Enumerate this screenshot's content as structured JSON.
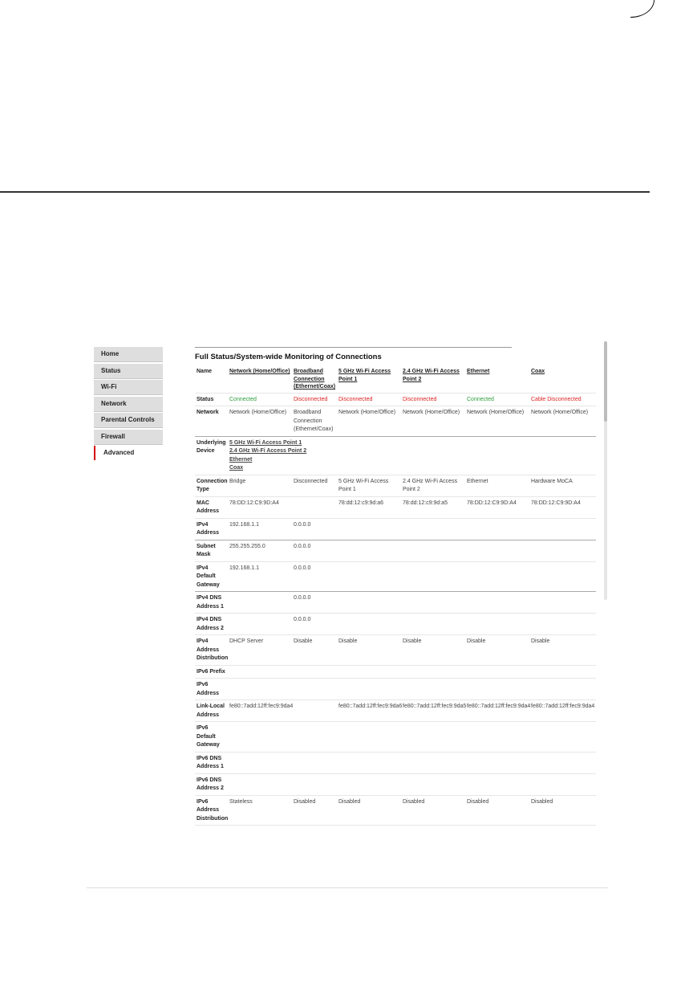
{
  "sidebar": {
    "items": [
      {
        "label": "Home"
      },
      {
        "label": "Status"
      },
      {
        "label": "Wi-Fi"
      },
      {
        "label": "Network"
      },
      {
        "label": "Parental Controls"
      },
      {
        "label": "Firewall"
      },
      {
        "label": "Advanced",
        "active": true
      }
    ]
  },
  "main": {
    "title": "Full Status/System-wide Monitoring of Connections",
    "columns": {
      "name_label": "Name",
      "c1": "Network (Home/Office)",
      "c2": "Broadband Connection (Ethernet/Coax)",
      "c3": "5 GHz Wi-Fi Access Point 1",
      "c4": "2.4 GHz Wi-Fi Access Point 2",
      "c5": "Ethernet",
      "c6": "Coax"
    },
    "rows": {
      "status": {
        "label": "Status",
        "c1": "Connected",
        "c2": "Disconnected",
        "c3": "Disconnected",
        "c4": "Disconnected",
        "c5": "Connected",
        "c6": "Cable Disconnected"
      },
      "network": {
        "label": "Network",
        "c1": "Network (Home/Office)",
        "c2": "Broadband Connection (Ethernet/Coax)",
        "c3": "Network (Home/Office)",
        "c4": "Network (Home/Office)",
        "c5": "Network (Home/Office)",
        "c6": "Network (Home/Office)"
      },
      "underlying": {
        "label": "Underlying Device",
        "links": [
          "5 GHz Wi-Fi Access Point 1",
          "2.4 GHz Wi-Fi Access Point 2",
          "Ethernet",
          "Coax"
        ]
      },
      "conn_type": {
        "label": "Connection Type",
        "c1": "Bridge",
        "c2": "Disconnected",
        "c3": "5 GHz Wi-Fi Access Point 1",
        "c4": "2.4 GHz Wi-Fi Access Point 2",
        "c5": "Ethernet",
        "c6": "Hardware MoCA"
      },
      "mac": {
        "label": "MAC Address",
        "c1": "78:DD:12:C9:9D:A4",
        "c2": "",
        "c3": "78:dd:12:c9:9d:a6",
        "c4": "78:dd:12:c9:9d:a5",
        "c5": "78:DD:12:C9:9D:A4",
        "c6": "78:DD:12:C9:9D:A4"
      },
      "ipv4": {
        "label": "IPv4 Address",
        "c1": "192.168.1.1",
        "c2": "0.0.0.0"
      },
      "subnet": {
        "label": "Subnet Mask",
        "c1": "255.255.255.0",
        "c2": "0.0.0.0"
      },
      "gateway": {
        "label": "IPv4 Default Gateway",
        "c1": "192.168.1.1",
        "c2": "0.0.0.0"
      },
      "dns1": {
        "label": "IPv4 DNS Address 1",
        "c2": "0.0.0.0"
      },
      "dns2": {
        "label": "IPv4 DNS Address 2",
        "c2": "0.0.0.0"
      },
      "ipv4_dist": {
        "label": "IPv4 Address Distribution",
        "c1": "DHCP Server",
        "c2": "Disable",
        "c3": "Disable",
        "c4": "Disable",
        "c5": "Disable",
        "c6": "Disable"
      },
      "ipv6_prefix": {
        "label": "IPv6 Prefix"
      },
      "ipv6_addr": {
        "label": "IPv6 Address"
      },
      "link_local": {
        "label": "Link-Local Address",
        "c1": "fe80::7add:12ff:fec9:9da4",
        "c3": "fe80::7add:12ff:fec9:9da6",
        "c4": "fe80::7add:12ff:fec9:9da5",
        "c5": "fe80::7add:12ff:fec9:9da4",
        "c6": "fe80::7add:12ff:fec9:9da4"
      },
      "ipv6_gw": {
        "label": "IPv6 Default Gateway"
      },
      "ipv6_dns1": {
        "label": "IPv6 DNS Address 1"
      },
      "ipv6_dns2": {
        "label": "IPv6 DNS Address 2"
      },
      "ipv6_dist": {
        "label": "IPv6 Address Distribution",
        "c1": "Stateless",
        "c2": "Disabled",
        "c3": "Disabled",
        "c4": "Disabled",
        "c5": "Disabled",
        "c6": "Disabled"
      }
    }
  },
  "colors": {
    "connected": "#2a9d3a",
    "disconnected": "#d22222",
    "active_marker": "#d40000"
  }
}
